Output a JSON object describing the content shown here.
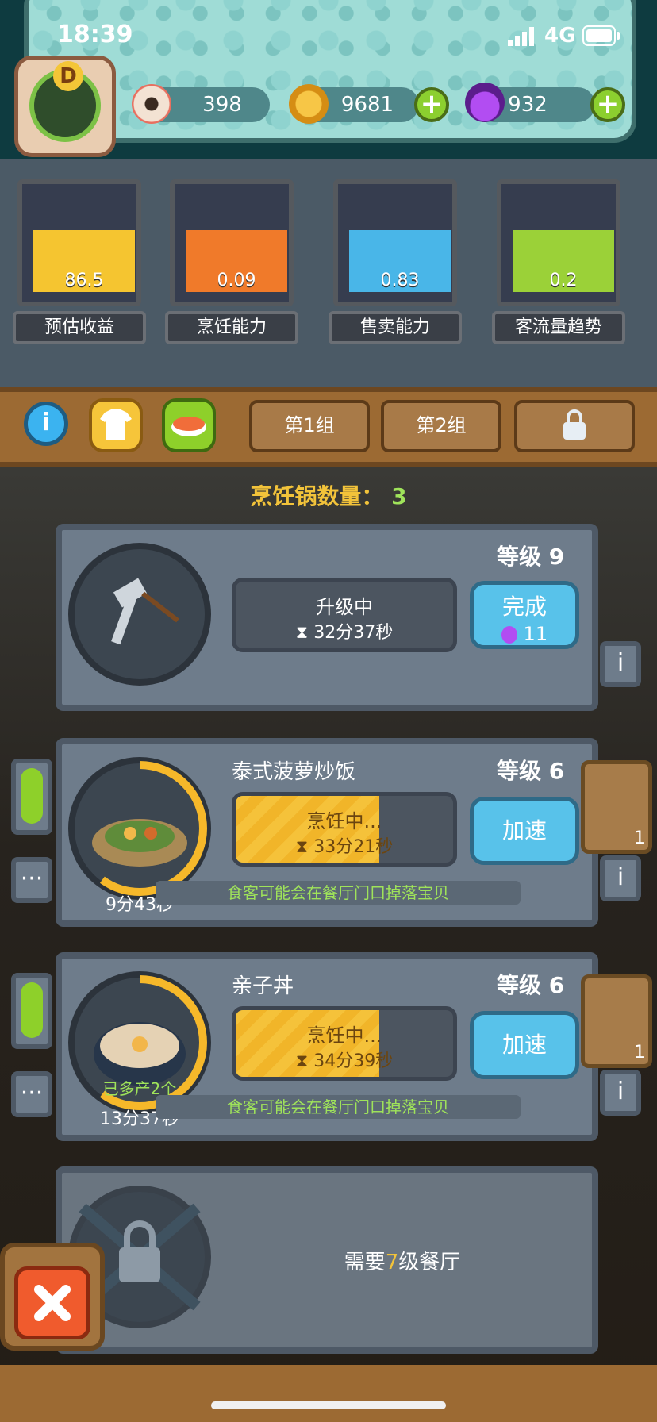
{
  "status_bar": {
    "time": "18:39",
    "network": "4G"
  },
  "resources": {
    "eye": "398",
    "coins": "9681",
    "potion": "932"
  },
  "avatar": {
    "badge": "D"
  },
  "meters": [
    {
      "label": "预估收益",
      "value": "86.5",
      "color": "#f5c530",
      "level": 0.57
    },
    {
      "label": "烹饪能力",
      "value": "0.09",
      "color": "#f07a2a",
      "level": 0.57
    },
    {
      "label": "售卖能力",
      "value": "0.83",
      "color": "#49b6e8",
      "level": 0.57
    },
    {
      "label": "客流量趋势",
      "value": "0.2",
      "color": "#9bd138",
      "level": 0.57
    }
  ],
  "tabs": {
    "group1": "第1组",
    "group2": "第2组"
  },
  "pot_count": {
    "label": "烹饪锅数量：",
    "value": "3"
  },
  "cards": [
    {
      "level": "等级 9",
      "status": "升级中",
      "timer": "32分37秒",
      "button": "完成",
      "cost": "11"
    },
    {
      "dish": "泰式菠萝炒饭",
      "level": "等级 6",
      "status": "烹饪中...",
      "timer": "33分21秒",
      "button": "加速",
      "countdown": "9分43秒",
      "hint": "食客可能会在餐厅门口掉落宝贝",
      "item_count": "1",
      "progress": 0.66
    },
    {
      "dish": "亲子丼",
      "level": "等级 6",
      "status": "烹饪中...",
      "timer": "34分39秒",
      "button": "加速",
      "extra": "已多产2个",
      "countdown": "13分37秒",
      "hint": "食客可能会在餐厅门口掉落宝贝",
      "item_count": "1",
      "progress": 0.66
    }
  ],
  "locked": {
    "prefix": "需要",
    "level": "7",
    "suffix": "级餐厅"
  },
  "colors": {
    "gold": "#f2c33a",
    "green_text": "#9fe35a",
    "blue_button": "#58c2ea"
  }
}
